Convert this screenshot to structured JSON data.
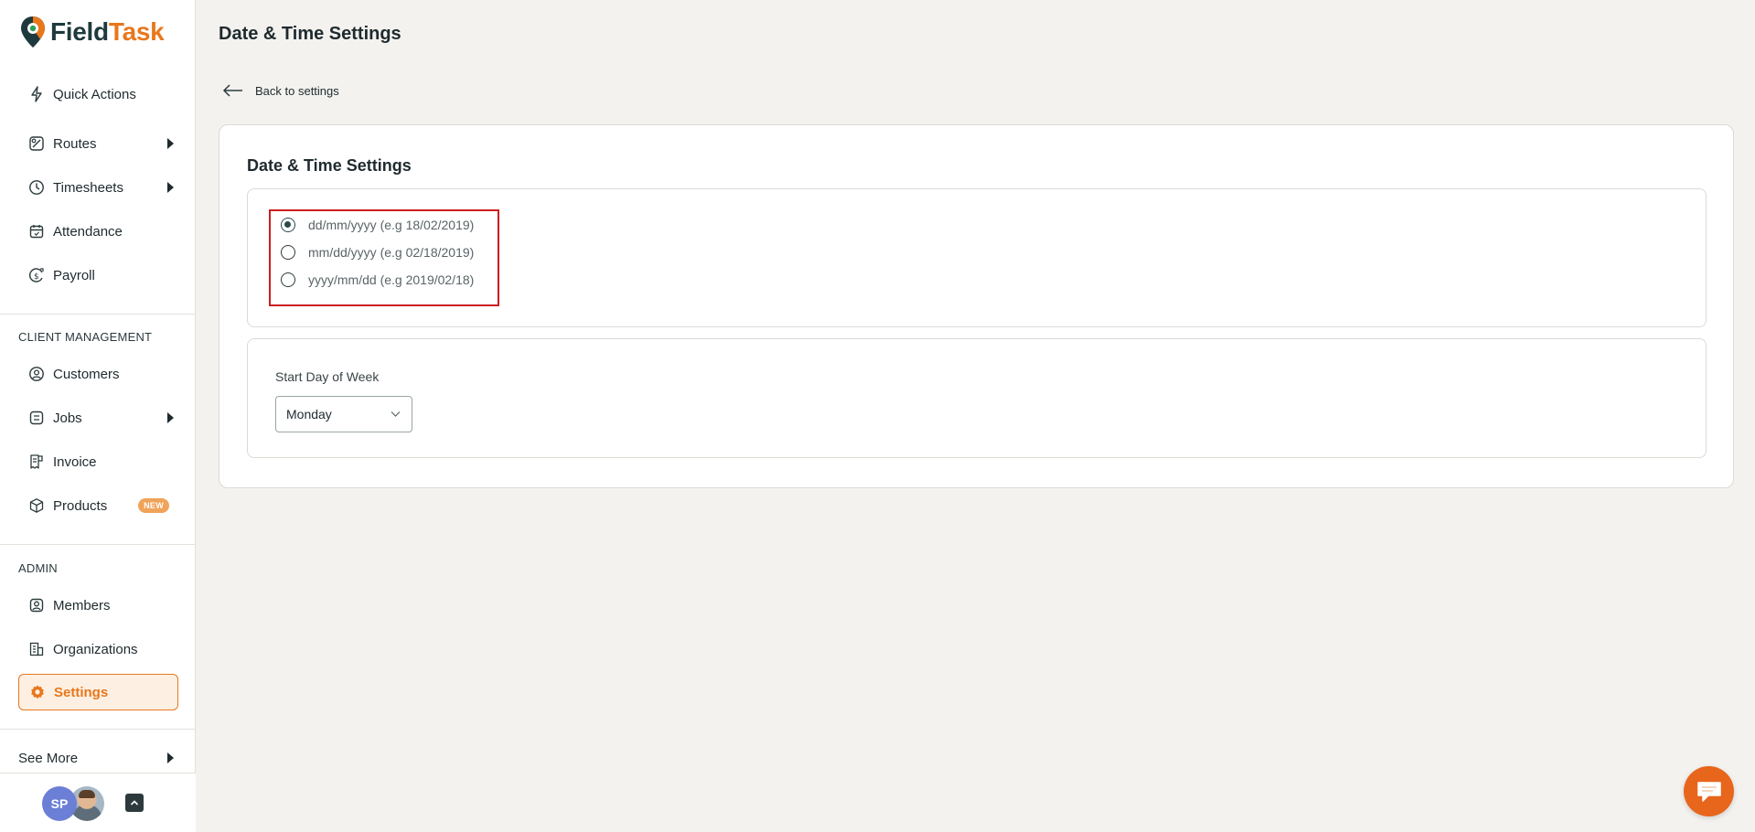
{
  "brand": {
    "field": "Field",
    "task": "Task"
  },
  "sidebar": {
    "items": [
      {
        "label": "Quick Actions",
        "icon": "lightning-icon"
      },
      {
        "label": "Routes",
        "icon": "route-map-icon",
        "has_submenu": true
      },
      {
        "label": "Timesheets",
        "icon": "clock-icon",
        "has_submenu": true
      },
      {
        "label": "Attendance",
        "icon": "calendar-check-icon"
      },
      {
        "label": "Payroll",
        "icon": "dollar-coin-icon"
      }
    ],
    "client_section_label": "CLIENT MANAGEMENT",
    "client_items": [
      {
        "label": "Customers",
        "icon": "user-circle-icon"
      },
      {
        "label": "Jobs",
        "icon": "job-list-icon",
        "has_submenu": true
      },
      {
        "label": "Invoice",
        "icon": "receipt-icon"
      },
      {
        "label": "Products",
        "icon": "box-icon",
        "badge": "NEW"
      }
    ],
    "admin_section_label": "ADMIN",
    "admin_items": [
      {
        "label": "Members",
        "icon": "member-id-icon"
      },
      {
        "label": "Organizations",
        "icon": "building-icon"
      },
      {
        "label": "Settings",
        "icon": "gear-icon",
        "active": true
      }
    ],
    "see_more_label": "See More",
    "user_initials": "SP"
  },
  "page": {
    "title": "Date & Time Settings",
    "back_label": "Back to settings",
    "card_title": "Date & Time Settings",
    "date_formats": [
      {
        "label": "dd/mm/yyyy (e.g 18/02/2019)",
        "selected": true
      },
      {
        "label": "mm/dd/yyyy (e.g 02/18/2019)",
        "selected": false
      },
      {
        "label": "yyyy/mm/dd (e.g 2019/02/18)",
        "selected": false
      }
    ],
    "week_start_label": "Start Day of Week",
    "week_start_value": "Monday"
  },
  "colors": {
    "accent": "#e8771c",
    "highlight_border": "#cc1f1f",
    "background": "#f3f2ef",
    "chat_fab": "#e8651c"
  }
}
